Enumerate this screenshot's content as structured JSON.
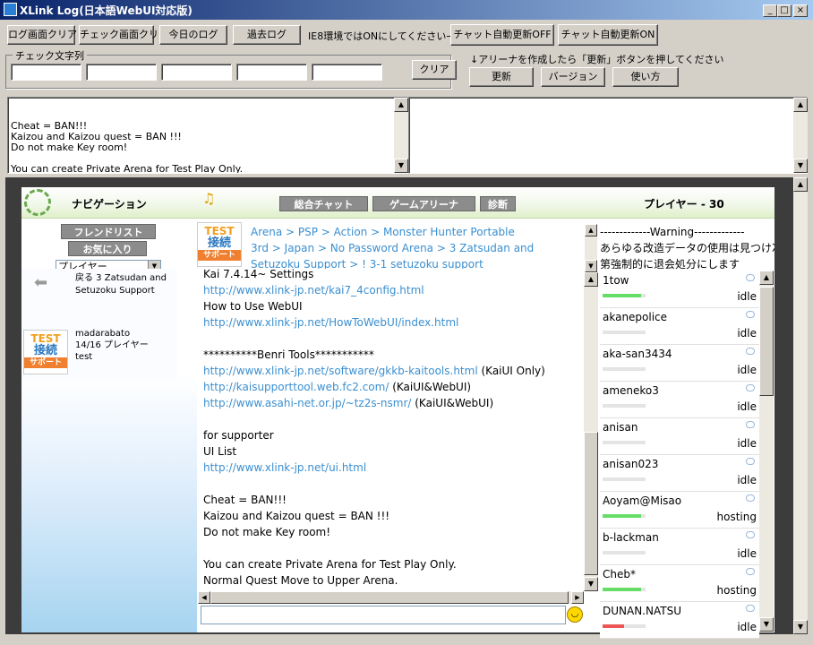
{
  "window": {
    "title": "XLink Log(日本語WebUI対応版)",
    "min": "_",
    "max": "□",
    "close": "×"
  },
  "toolbar": {
    "buttons": [
      "ログ画面クリア",
      "チェック画面クリア",
      "今日のログ",
      "過去ログ"
    ],
    "ie8_note": "IE8環境ではONにしてください→",
    "auto_off": "チャット自動更新OFF",
    "auto_on": "チャット自動更新ON",
    "check_label": "チェック文字列",
    "clear": "クリア",
    "arena_note": "↓アリーナを作成したら「更新」ボタンを押してください",
    "update": "更新",
    "version": "バージョン",
    "howto": "使い方"
  },
  "log": [
    "Cheat = BAN!!!",
    "Kaizou and Kaizou quest = BAN !!!",
    "Do not make Key room!",
    "",
    "You can create Private Arena for Test Play Only.",
    "Normal Quest Move to Upper Arena."
  ],
  "nav": {
    "title": "ナビゲーション",
    "friend": "フレンドリスト",
    "fav": "お気に入り",
    "select": "プレイヤー",
    "back_text": [
      "戻る 3 Zatsudan and",
      "Setuzoku Support"
    ],
    "room": {
      "name": "madarabato",
      "count": "14/16 プレイヤー",
      "desc": "test"
    }
  },
  "tabs": {
    "chat": "総合チャット",
    "arena": "ゲームアリーナ",
    "diag": "診断"
  },
  "breadcrumb": [
    "Arena > PSP > Action > Monster Hunter Portable",
    "3rd > Japan > No Password Arena > 3 Zatsudan and",
    "Setuzoku Support > ! 3-1 setuzoku support"
  ],
  "badge": {
    "top": "TEST",
    "mid": "接続",
    "bot": "サポート"
  },
  "chat": [
    {
      "text": "Kai 7.4.14~ Settings",
      "link": false
    },
    {
      "text": "http://www.xlink-jp.net/kai7_4config.html",
      "link": true
    },
    {
      "text": "How to Use WebUI",
      "link": false
    },
    {
      "text": "http://www.xlink-jp.net/HowToWebUI/index.html",
      "link": true
    },
    {
      "text": "",
      "link": false
    },
    {
      "text": "**********Benri Tools***********",
      "link": false
    },
    {
      "text": "http://www.xlink-jp.net/software/gkkb-kaitools.html",
      "link": true,
      "suffix": " (KaiUI Only)"
    },
    {
      "text": "http://kaisupporttool.web.fc2.com/",
      "link": true,
      "suffix": " (KaiUI&WebUI)"
    },
    {
      "text": "http://www.asahi-net.or.jp/~tz2s-nsmr/",
      "link": true,
      "suffix": " (KaiUI&WebUI)"
    },
    {
      "text": "",
      "link": false
    },
    {
      "text": "for supporter",
      "link": false
    },
    {
      "text": "UI List",
      "link": false
    },
    {
      "text": "http://www.xlink-jp.net/ui.html",
      "link": true
    },
    {
      "text": "",
      "link": false
    },
    {
      "text": "Cheat = BAN!!!",
      "link": false
    },
    {
      "text": "Kaizou and Kaizou quest = BAN !!!",
      "link": false
    },
    {
      "text": "Do not make Key room!",
      "link": false
    },
    {
      "text": "",
      "link": false
    },
    {
      "text": "You can create Private Arena for Test Play Only.",
      "link": false
    },
    {
      "text": "Normal Quest Move to Upper Arena.",
      "link": false
    }
  ],
  "players_panel": {
    "title": "プレイヤー - 30",
    "warning": [
      "-------------Warning-------------",
      "あらゆる改造データの使用は見つけ次",
      "第強制的に退会処分にします"
    ]
  },
  "players": [
    {
      "name": "1tow",
      "status": "idle",
      "level": 0.9,
      "color": "#66dd66"
    },
    {
      "name": "akanepolice",
      "status": "idle",
      "level": 0,
      "color": "#66dd66"
    },
    {
      "name": "aka-san3434",
      "status": "idle",
      "level": 0,
      "color": "#66dd66"
    },
    {
      "name": "ameneko3",
      "status": "idle",
      "level": 0,
      "color": "#66dd66"
    },
    {
      "name": "anisan",
      "status": "idle",
      "level": 0,
      "color": "#66dd66"
    },
    {
      "name": "anisan023",
      "status": "idle",
      "level": 0,
      "color": "#66dd66"
    },
    {
      "name": "Aoyam@Misao",
      "status": "hosting",
      "level": 0.9,
      "color": "#66dd66"
    },
    {
      "name": "b-lackman",
      "status": "idle",
      "level": 0,
      "color": "#66dd66"
    },
    {
      "name": "Cheb*",
      "status": "hosting",
      "level": 0.9,
      "color": "#66dd66"
    },
    {
      "name": "DUNAN.NATSU",
      "status": "idle",
      "level": 0.5,
      "color": "#ee5555"
    }
  ]
}
